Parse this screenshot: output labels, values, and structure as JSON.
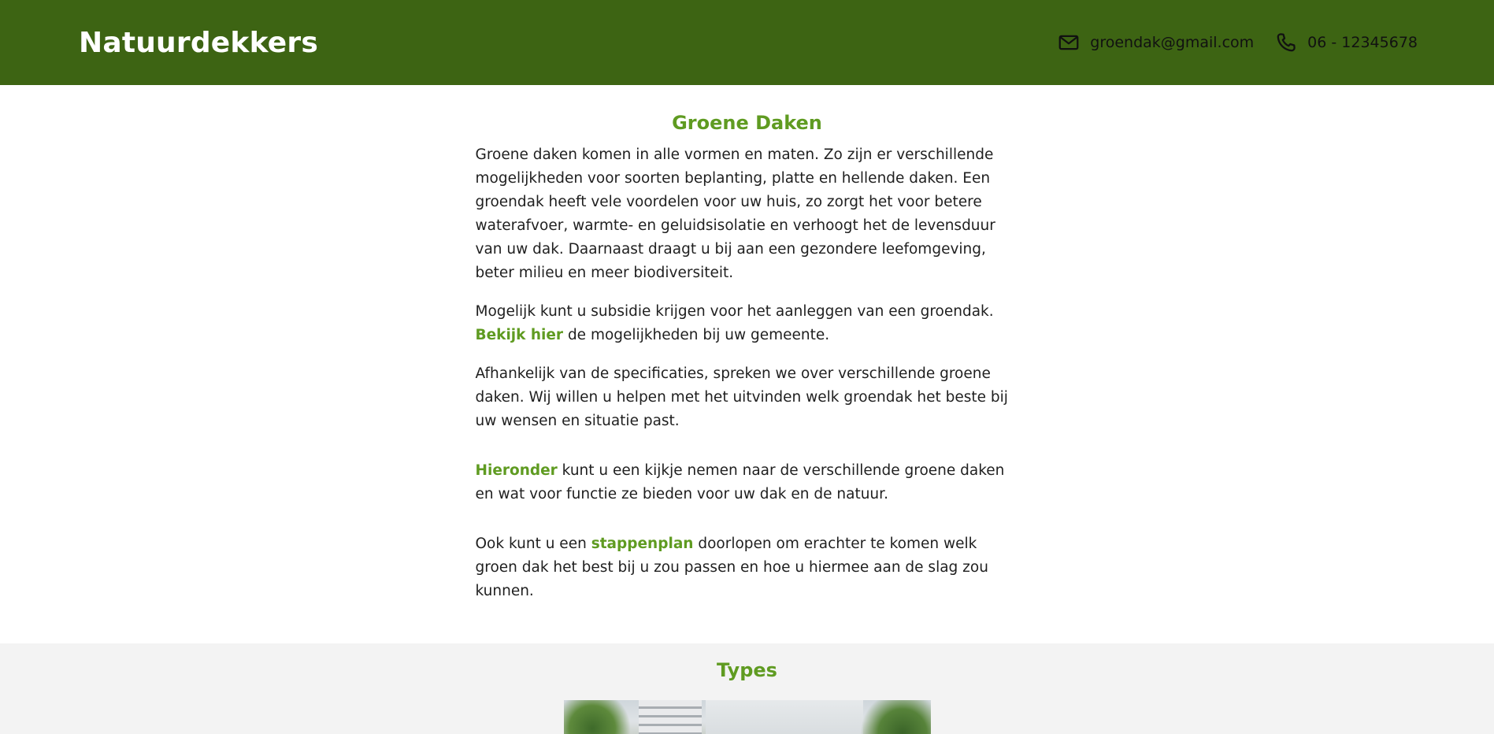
{
  "header": {
    "brand": "Natuurdekkers",
    "email": "groendak@gmail.com",
    "phone": "06 - 12345678"
  },
  "intro": {
    "title": "Groene Daken",
    "p1": "Groene daken komen in alle vormen en maten. Zo zijn er verschillende mogelijkheden voor soorten beplanting, platte en hellende daken. Een groendak heeft vele voordelen voor uw huis, zo zorgt het voor betere waterafvoer, warmte- en geluidsisolatie en verhoogt het de levensduur van uw dak. Daarnaast draagt u bij aan een gezondere leefomgeving, beter milieu en meer biodiversiteit.",
    "p2_before": "Mogelijk kunt u subsidie krijgen voor het aanleggen van een groendak. ",
    "p2_link": "Bekijk hier",
    "p2_after": " de mogelijkheden bij uw gemeente.",
    "p3": "Afhankelijk van de specificaties, spreken we over verschillende groene daken. Wij willen u helpen met het uitvinden welk groendak het beste bij uw wensen en situatie past.",
    "p4_link": "Hieronder",
    "p4_after": " kunt u een kijkje nemen naar de verschillende groene daken en wat voor functie ze bieden voor uw dak en de natuur.",
    "p5_before": "Ook kunt u een ",
    "p5_link": "stappenplan",
    "p5_after": " doorlopen om erachter te komen welk groen dak het best bij u zou passen en hoe u hiermee aan de slag zou kunnen."
  },
  "types": {
    "title": "Types"
  },
  "colors": {
    "header_bg": "#3d6413",
    "accent": "#5f9b21",
    "section_bg": "#f3f3f3"
  },
  "icons": {
    "email": "mail-icon",
    "phone": "phone-icon"
  }
}
